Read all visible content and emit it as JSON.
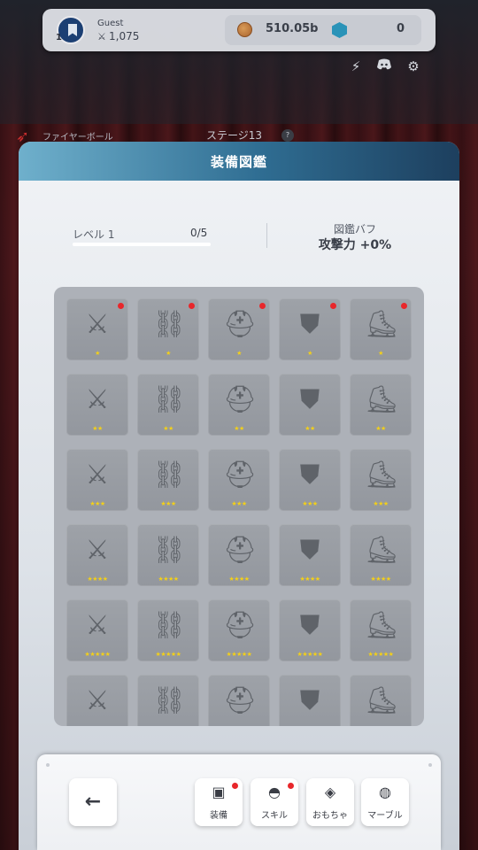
{
  "hud": {
    "player_name": "Guest",
    "player_level": "1",
    "power_icon": "crossed-swords-icon",
    "power_value": "1,075",
    "coins": "510.05b",
    "gems": "0"
  },
  "stage": {
    "skill_name": "ファイヤーボール",
    "stage_name": "ステージ13",
    "help": "?"
  },
  "panel": {
    "title": "装備図鑑",
    "level_label": "レベル 1",
    "level_count": "0/5",
    "level_progress": 0,
    "buff_label": "図鑑バフ",
    "buff_value": "攻撃力 +0%"
  },
  "collection": {
    "rows": [
      {
        "stars": "★",
        "items": [
          {
            "icon": "sword-icon",
            "new": true
          },
          {
            "icon": "pants-icon",
            "new": true
          },
          {
            "icon": "helmet-icon",
            "new": true
          },
          {
            "icon": "armor-icon",
            "new": true
          },
          {
            "icon": "boots-icon",
            "new": true
          }
        ]
      },
      {
        "stars": "★★",
        "items": [
          {
            "icon": "sword-icon",
            "new": false
          },
          {
            "icon": "pants-icon",
            "new": false
          },
          {
            "icon": "helmet-icon",
            "new": false
          },
          {
            "icon": "armor-icon",
            "new": false
          },
          {
            "icon": "boots-icon",
            "new": false
          }
        ]
      },
      {
        "stars": "★★★",
        "items": [
          {
            "icon": "sword-icon",
            "new": false
          },
          {
            "icon": "pants-icon",
            "new": false
          },
          {
            "icon": "helmet-icon",
            "new": false
          },
          {
            "icon": "armor-icon",
            "new": false
          },
          {
            "icon": "boots-icon",
            "new": false
          }
        ]
      },
      {
        "stars": "★★★★",
        "items": [
          {
            "icon": "sword-icon",
            "new": false
          },
          {
            "icon": "pants-icon",
            "new": false
          },
          {
            "icon": "helmet-icon",
            "new": false
          },
          {
            "icon": "armor-icon",
            "new": false
          },
          {
            "icon": "boots-icon",
            "new": false
          }
        ]
      },
      {
        "stars": "★★★★★",
        "items": [
          {
            "icon": "sword-icon",
            "new": false
          },
          {
            "icon": "pants-icon",
            "new": false
          },
          {
            "icon": "helmet-icon",
            "new": false
          },
          {
            "icon": "armor-icon",
            "new": false
          },
          {
            "icon": "boots-icon",
            "new": false
          }
        ]
      },
      {
        "stars": "",
        "items": [
          {
            "icon": "sword-icon",
            "new": false
          },
          {
            "icon": "pants-icon",
            "new": false
          },
          {
            "icon": "helmet-icon",
            "new": false
          },
          {
            "icon": "armor-icon",
            "new": false
          },
          {
            "icon": "boots-icon",
            "new": false
          }
        ]
      }
    ]
  },
  "bottom_nav": {
    "back_icon": "arrow-left-icon",
    "buttons": [
      {
        "label": "装備",
        "icon": "equipment-icon",
        "badge": true
      },
      {
        "label": "スキル",
        "icon": "skill-icon",
        "badge": true
      },
      {
        "label": "おもちゃ",
        "icon": "toy-icon",
        "badge": false
      },
      {
        "label": "マーブル",
        "icon": "marble-icon",
        "badge": false
      }
    ]
  },
  "colors": {
    "header_start": "#6fb0cc",
    "header_end": "#1d3f5e",
    "badge_red": "#e8272b",
    "star_yellow": "#f2cf1a"
  }
}
